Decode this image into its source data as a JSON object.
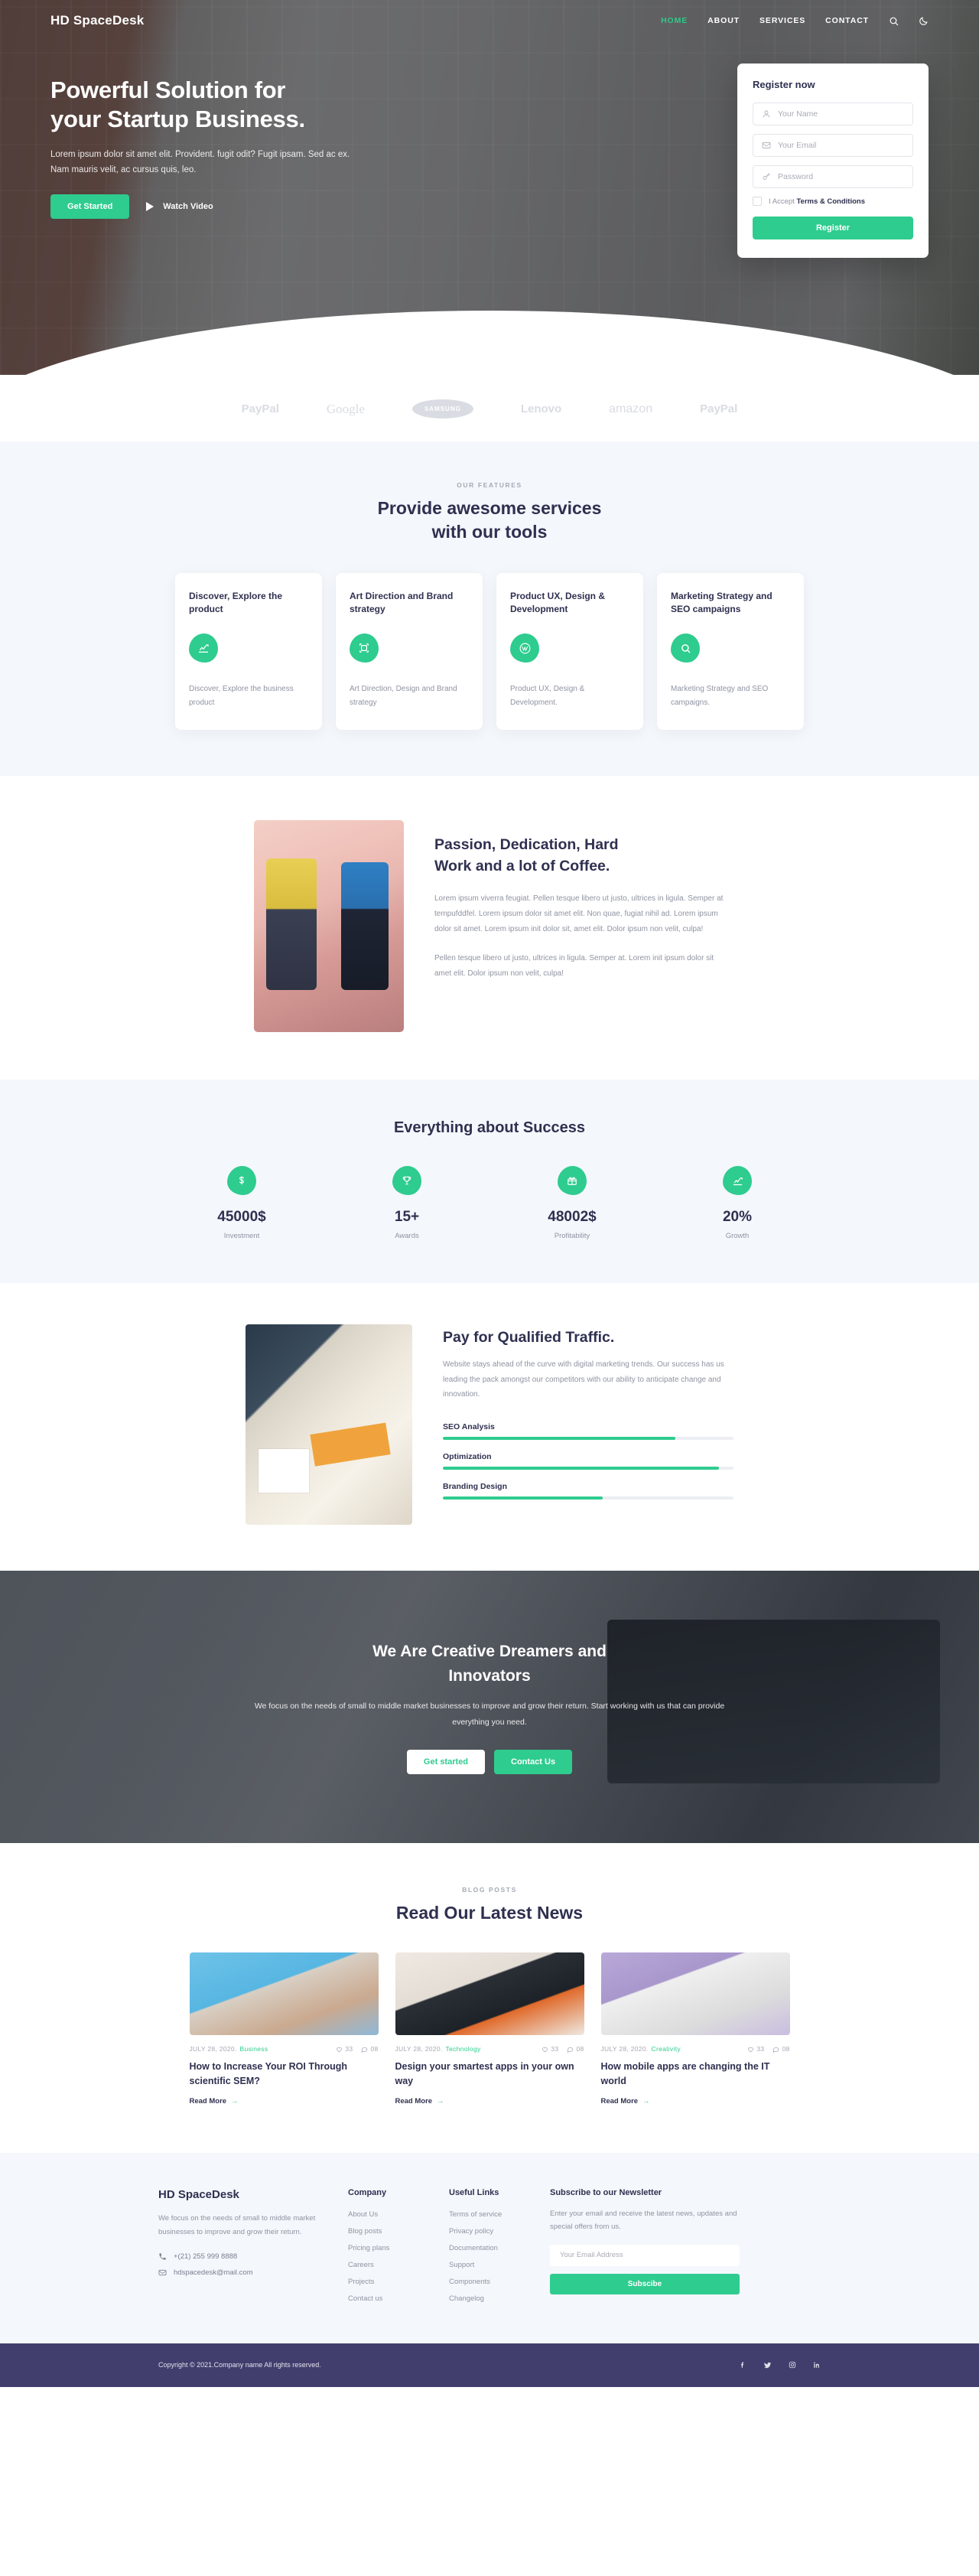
{
  "brand": "HD SpaceDesk",
  "nav": {
    "links": [
      {
        "label": "HOME",
        "active": true
      },
      {
        "label": "ABOUT",
        "active": false
      },
      {
        "label": "SERVICES",
        "active": false
      },
      {
        "label": "CONTACT",
        "active": false
      }
    ],
    "search_icon": "search-icon",
    "theme_icon": "moon-icon"
  },
  "hero": {
    "title_line1": "Powerful Solution for",
    "title_line2": "your Startup Business.",
    "subtitle": "Lorem ipsum dolor sit amet elit. Provident. fugit odit? Fugit ipsam. Sed ac ex. Nam mauris velit, ac cursus quis, leo.",
    "primary_btn": "Get Started",
    "watch_label": "Watch Video"
  },
  "register": {
    "title": "Register now",
    "name_placeholder": "Your Name",
    "email_placeholder": "Your Email",
    "password_placeholder": "Password",
    "terms_prefix": "I Accept ",
    "terms_link": "Terms & Conditions",
    "submit": "Register"
  },
  "logos": [
    {
      "name": "PayPal",
      "kind": "paypal"
    },
    {
      "name": "Google",
      "kind": "google"
    },
    {
      "name": "SAMSUNG",
      "kind": "samsung"
    },
    {
      "name": "Lenovo",
      "kind": "plain"
    },
    {
      "name": "amazon",
      "kind": "amazon"
    },
    {
      "name": "PayPal",
      "kind": "paypal"
    }
  ],
  "features": {
    "eyebrow": "OUR FEATURES",
    "title_line1": "Provide awesome services",
    "title_line2": "with our tools",
    "cards": [
      {
        "title": "Discover, Explore the product",
        "icon": "chart-line-icon",
        "desc": "Discover, Explore the business product"
      },
      {
        "title": "Art Direction and Brand strategy",
        "icon": "crop-frame-icon",
        "desc": "Art Direction, Design and Brand strategy"
      },
      {
        "title": "Product UX, Design & Development",
        "icon": "wordpress-icon",
        "desc": "Product UX, Design & Development."
      },
      {
        "title": "Marketing Strategy and SEO campaigns",
        "icon": "search-icon",
        "desc": "Marketing Strategy and SEO campaigns."
      }
    ]
  },
  "passion": {
    "title_line1": "Passion, Dedication, Hard",
    "title_line2": "Work and a lot of Coffee.",
    "para1": "Lorem ipsum viverra feugiat. Pellen tesque libero ut justo, ultrices in ligula. Semper at tempufddfel. Lorem ipsum dolor sit amet elit. Non quae, fugiat nihil ad. Lorem ipsum dolor sit amet. Lorem ipsum init dolor sit, amet elit. Dolor ipsum non velit, culpa!",
    "para2": "Pellen tesque libero ut justo, ultrices in ligula. Semper at. Lorem init ipsum dolor sit amet elit. Dolor ipsum non velit, culpa!",
    "image_alt": "two-women-on-couch-photo"
  },
  "stats": {
    "title": "Everything about Success",
    "items": [
      {
        "icon": "dollar-icon",
        "value": "45000$",
        "label": "Investment"
      },
      {
        "icon": "trophy-icon",
        "value": "15+",
        "label": "Awards"
      },
      {
        "icon": "gift-icon",
        "value": "48002$",
        "label": "Profitability"
      },
      {
        "icon": "chart-line-icon",
        "value": "20%",
        "label": "Growth"
      }
    ]
  },
  "traffic": {
    "title": "Pay for Qualified Traffic.",
    "desc": "Website stays ahead of the curve with digital marketing trends. Our success has us leading the pack amongst our competitors with our ability to anticipate change and innovation.",
    "image_alt": "team-reviewing-charts-photo",
    "bars": [
      {
        "label": "SEO Analysis",
        "percent": 80
      },
      {
        "label": "Optimization",
        "percent": 95
      },
      {
        "label": "Branding Design",
        "percent": 55
      }
    ]
  },
  "cta": {
    "title_line1": "We Are Creative Dreamers and",
    "title_line2": "Innovators",
    "desc": "We focus on the needs of small to middle market businesses to improve and grow their return. Start working with us that can provide everything you need.",
    "btn_light": "Get started",
    "btn_primary": "Contact Us"
  },
  "blog": {
    "eyebrow": "BLOG POSTS",
    "title": "Read Our Latest News",
    "read_more": "Read More",
    "posts": [
      {
        "date": "JULY 28, 2020.",
        "category": "Business",
        "likes": "33",
        "comments": "08",
        "title": "How to Increase Your ROI Through scientific SEM?",
        "image": "vr-headset-photo"
      },
      {
        "date": "JULY 28, 2020.",
        "category": "Technology",
        "likes": "33",
        "comments": "08",
        "title": "Design your smartest apps in your own way",
        "image": "desk-imac-photo"
      },
      {
        "date": "JULY 28, 2020.",
        "category": "Creativity",
        "likes": "33",
        "comments": "08",
        "title": "How mobile apps are changing the IT world",
        "image": "robot-asimo-photo"
      }
    ]
  },
  "footer": {
    "brand": "HD SpaceDesk",
    "desc": "We focus on the needs of small to middle market businesses to improve and grow their return.",
    "phone": "+(21) 255 999 8888",
    "email": "hdspacedesk@mail.com",
    "company": {
      "heading": "Company",
      "links": [
        "About Us",
        "Blog posts",
        "Pricing plans",
        "Careers",
        "Projects",
        "Contact us"
      ]
    },
    "useful": {
      "heading": "Useful Links",
      "links": [
        "Terms of service",
        "Privacy policy",
        "Documentation",
        "Support",
        "Components",
        "Changelog"
      ]
    },
    "newsletter": {
      "heading": "Subscribe to our Newsletter",
      "desc": "Enter your email and receive the latest news, updates and special offers from us.",
      "placeholder": "Your Email Address",
      "button": "Subscibe"
    },
    "copyright": "Copyright © 2021.Company name All rights reserved.",
    "socials": [
      "facebook-icon",
      "twitter-icon",
      "instagram-icon",
      "linkedin-icon"
    ]
  },
  "colors": {
    "accent": "#2ecc8f",
    "heading": "#2f3050",
    "muted": "#9093a2",
    "footer_bar": "#413e6e",
    "section_bg": "#f4f7fb"
  }
}
